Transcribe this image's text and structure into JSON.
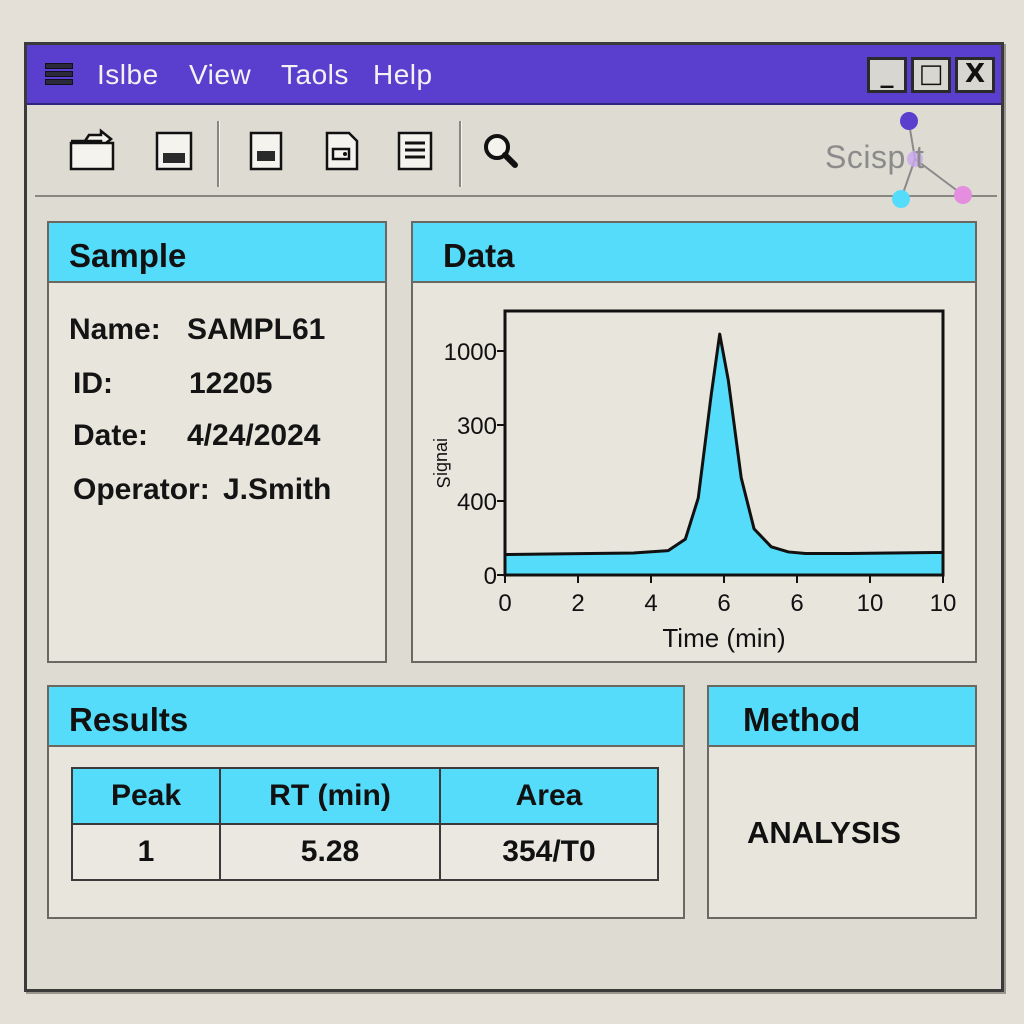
{
  "menu": {
    "items": [
      "Islbe",
      "View",
      "Taols",
      "Help"
    ]
  },
  "window_buttons": {
    "minimize": "_",
    "maximize": "□",
    "close": "X"
  },
  "toolbar": {
    "tools": [
      "open-folder-icon",
      "save-icon",
      "document-icon",
      "export-icon",
      "print-icon",
      "zoom-icon"
    ]
  },
  "logo": {
    "text": "Scisp t"
  },
  "sample": {
    "title": "Sample",
    "fields": [
      {
        "label": "Name:",
        "value": "SAMPL61"
      },
      {
        "label": "ID:",
        "value": "12205"
      },
      {
        "label": "Date:",
        "value": "4/24/2024"
      },
      {
        "label": "Operator:",
        "value": "J.Smith"
      }
    ]
  },
  "data_panel": {
    "title": "Data"
  },
  "chart_data": {
    "type": "area",
    "xlabel": "Time (min)",
    "ylabel": "ᴉɐuƃᴉS",
    "x_ticks": [
      "0",
      "2",
      "4",
      "6",
      "6",
      "10",
      "10"
    ],
    "y_ticks": [
      "0",
      "400",
      "300",
      "1000"
    ],
    "x": [
      0,
      1,
      2,
      3,
      3.8,
      4.2,
      4.5,
      4.8,
      5.0,
      5.2,
      5.5,
      5.8,
      6.2,
      6.6,
      7,
      8,
      9,
      10,
      10.2
    ],
    "y": [
      80,
      82,
      84,
      86,
      95,
      140,
      300,
      700,
      940,
      760,
      380,
      180,
      110,
      90,
      84,
      84,
      86,
      88,
      88
    ],
    "xlim": [
      0,
      10.2
    ],
    "ylim": [
      0,
      1030
    ],
    "fill_color": "#55dcfa",
    "grid": false
  },
  "results": {
    "title": "Results",
    "columns": [
      "Peak",
      "RT (min)",
      "Area"
    ],
    "rows": [
      [
        "1",
        "5.28",
        "354/T0"
      ]
    ]
  },
  "method": {
    "title": "Method",
    "value": "ANALYSIS"
  },
  "colors": {
    "titlebar": "#5a3fcf",
    "header": "#55dcfa",
    "panel": "#e8e5dd"
  }
}
